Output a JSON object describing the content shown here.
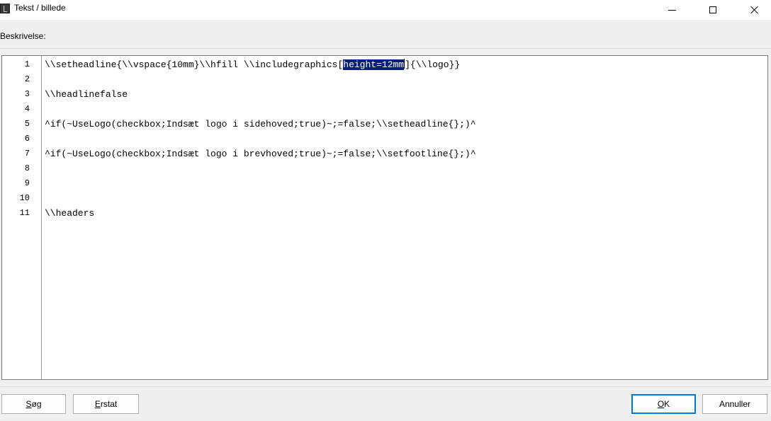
{
  "window": {
    "title": "Tekst / billede",
    "icon": "app-document-icon"
  },
  "description": {
    "label": "Beskrivelse:"
  },
  "editor": {
    "lines": [
      {
        "num": "1",
        "before": "\\\\setheadline{\\\\vspace{10mm}\\\\hfill \\\\includegraphics[",
        "selected": "height=12mm",
        "after": "]{\\\\logo}}"
      },
      {
        "num": "2",
        "text": ""
      },
      {
        "num": "3",
        "text": "\\\\headlinefalse"
      },
      {
        "num": "4",
        "text": ""
      },
      {
        "num": "5",
        "text": "^if(~UseLogo(checkbox;Indsæt logo i sidehoved;true)~;=false;\\\\setheadline{};)^"
      },
      {
        "num": "6",
        "text": ""
      },
      {
        "num": "7",
        "text": "^if(~UseLogo(checkbox;Indsæt logo i brevhoved;true)~;=false;\\\\setfootline{};)^"
      },
      {
        "num": "8",
        "text": ""
      },
      {
        "num": "9",
        "text": ""
      },
      {
        "num": "10",
        "text": ""
      },
      {
        "num": "11",
        "text": "\\\\headers"
      }
    ]
  },
  "buttons": {
    "search": {
      "accel": "S",
      "rest": "øg"
    },
    "replace": {
      "accel": "E",
      "rest": "rstat"
    },
    "ok": {
      "accel": "O",
      "rest": "K"
    },
    "cancel": "Annuller"
  },
  "colors": {
    "selection": "#0a1f7c",
    "default_button_border": "#0078d7"
  }
}
